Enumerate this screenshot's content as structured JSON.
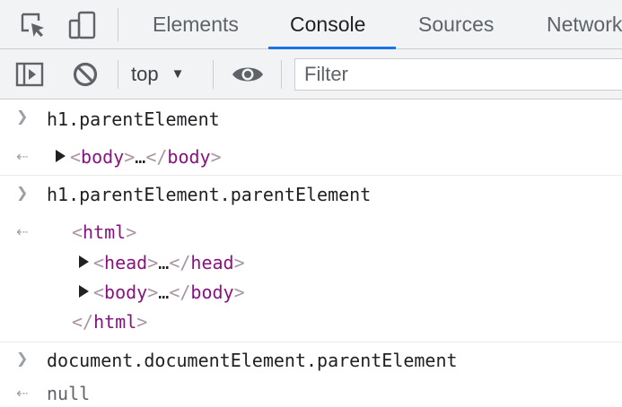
{
  "tabs": [
    {
      "label": "Elements",
      "active": false
    },
    {
      "label": "Console",
      "active": true
    },
    {
      "label": "Sources",
      "active": false
    },
    {
      "label": "Network",
      "active": false
    }
  ],
  "toolbar_icons": {
    "inspect": "inspect-element-icon",
    "device": "device-toolbar-icon",
    "sidebar": "show-sidebar-icon",
    "clear": "clear-console-icon",
    "live_expression": "eye-icon"
  },
  "toolbar": {
    "context": "top",
    "filter_placeholder": "Filter"
  },
  "console": {
    "entries": [
      {
        "input": "h1.parentElement",
        "result": {
          "open": "<",
          "tag_open": "body",
          "close1": ">",
          "ellipsis": "…",
          "close_open": "</",
          "tag_close": "body",
          "close2": ">"
        }
      },
      {
        "input": "h1.parentElement.parentElement",
        "result": {
          "html_open": "html",
          "head": "head",
          "body": "body",
          "html_close": "html",
          "ellipsis": "…"
        }
      },
      {
        "input": "document.documentElement.parentElement",
        "result_text": "null"
      }
    ]
  },
  "colors": {
    "accent": "#1a73e8",
    "tag": "#881280",
    "bracket": "#a894a6",
    "toolbar_bg": "#f1f3f4"
  }
}
